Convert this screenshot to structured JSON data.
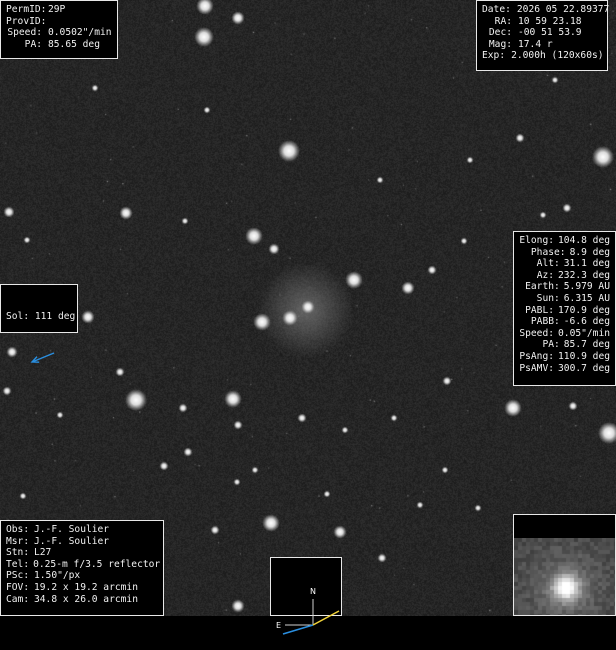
{
  "object_panel": {
    "rows": [
      {
        "key": "PermID:",
        "value": "29P"
      },
      {
        "key": "ProvID:",
        "value": ""
      },
      {
        "key": "Speed:",
        "value": "0.0502\"/min"
      },
      {
        "key": "PA:",
        "value": "85.65 deg"
      }
    ]
  },
  "time_panel": {
    "rows": [
      {
        "key": "Date:",
        "value": "2026 05 22.89377"
      },
      {
        "key": "RA:",
        "value": "10 59 23.18"
      },
      {
        "key": "Dec:",
        "value": "-00 51 53.9"
      },
      {
        "key": "Mag:",
        "value": "17.4 r"
      },
      {
        "key": "Exp:",
        "value": "2.000h (120x60s)"
      }
    ]
  },
  "sol_panel": {
    "label": "Sol: 111 deg",
    "arrow_color": "#2a8fe0"
  },
  "geometry_panel": {
    "rows": [
      {
        "key": "Elong:",
        "value": "104.8 deg"
      },
      {
        "key": "Phase:",
        "value": "8.9 deg"
      },
      {
        "key": "Alt:",
        "value": "31.1 deg"
      },
      {
        "key": "Az:",
        "value": "232.3 deg"
      },
      {
        "key": "Earth:",
        "value": "5.979 AU"
      },
      {
        "key": "Sun:",
        "value": "6.315 AU"
      },
      {
        "key": "PABL:",
        "value": "170.9 deg"
      },
      {
        "key": "PABB:",
        "value": "-6.6 deg"
      },
      {
        "key": "Speed:",
        "value": "0.05\"/min"
      },
      {
        "key": "PA:",
        "value": "85.7 deg"
      },
      {
        "key": "PsAng:",
        "value": "110.9 deg"
      },
      {
        "key": "PsAMV:",
        "value": "300.7 deg"
      }
    ]
  },
  "observer_panel": {
    "rows": [
      {
        "key": "Obs:",
        "value": "J.-F. Soulier"
      },
      {
        "key": "Msr:",
        "value": "J.-F. Soulier"
      },
      {
        "key": "Stn:",
        "value": "L27"
      },
      {
        "key": "Tel:",
        "value": "0.25-m f/3.5 reflector"
      },
      {
        "key": "PSc:",
        "value": "1.50\"/px"
      },
      {
        "key": "FOV:",
        "value": "19.2 x 19.2 arcmin"
      },
      {
        "key": "Cam:",
        "value": "34.8 x 26.0 arcmin"
      }
    ]
  },
  "compass": {
    "north_label": "N",
    "east_label": "E",
    "sun_vector_color": "#2a8fe0",
    "motion_vector_color": "#f0d23a"
  },
  "colors": {
    "background": "#000000",
    "panel_border": "#e8e8e8",
    "panel_text": "#f2f2f2"
  }
}
